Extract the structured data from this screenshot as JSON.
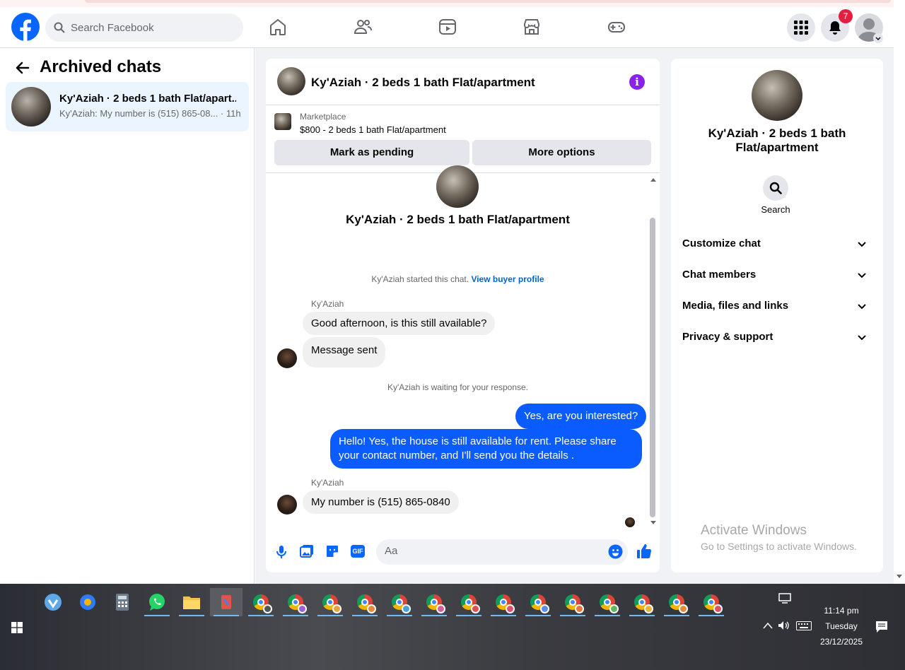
{
  "topbar": {
    "search_placeholder": "Search Facebook",
    "notification_count": "7",
    "brand_color": "#0866ff"
  },
  "left_pane": {
    "title": "Archived chats",
    "chats": [
      {
        "name": "Ky'Aziah · 2 beds 1 bath Flat/apart...",
        "preview": "Ky'Aziah: My number is (515) 865-08... · 11h"
      }
    ]
  },
  "chat": {
    "title": "Ky'Aziah · 2 beds 1 bath Flat/apartment",
    "marketplace_label": "Marketplace",
    "listing": "$800 - 2 beds 1 bath Flat/apartment",
    "mark_pending": "Mark as pending",
    "more_options": "More options",
    "intro_name": "Ky'Aziah · 2 beds 1 bath Flat/apartment",
    "started_text": "Ky'Aziah started this chat.",
    "view_buyer_profile": "View buyer profile",
    "waiting_text": "Ky'Aziah is waiting for your response.",
    "messages": [
      {
        "sender": "Ky'Aziah",
        "text": "Good afternoon, is this still available?"
      },
      {
        "text": "Message sent"
      },
      {
        "text": "Yes, are you interested?"
      },
      {
        "text": "Hello! Yes, the house is still available for rent. Please share your contact number, and I'll send you the details ."
      },
      {
        "sender": "Ky'Aziah",
        "text": "My number is (515) 865-0840"
      }
    ],
    "composer_placeholder": "Aa",
    "outgoing_bubble_color": "#0a5cff",
    "gif_label": "GIF"
  },
  "details": {
    "name": "Ky'Aziah · 2 beds 1 bath Flat/apartment",
    "search_label": "Search",
    "sections": [
      "Customize chat",
      "Chat members",
      "Media, files and links",
      "Privacy & support"
    ]
  },
  "watermark": {
    "line1": "Activate Windows",
    "line2": "Go to Settings to activate Windows."
  },
  "taskbar": {
    "time": "11:14 pm",
    "day": "Tuesday",
    "date": "23/12/2025"
  }
}
